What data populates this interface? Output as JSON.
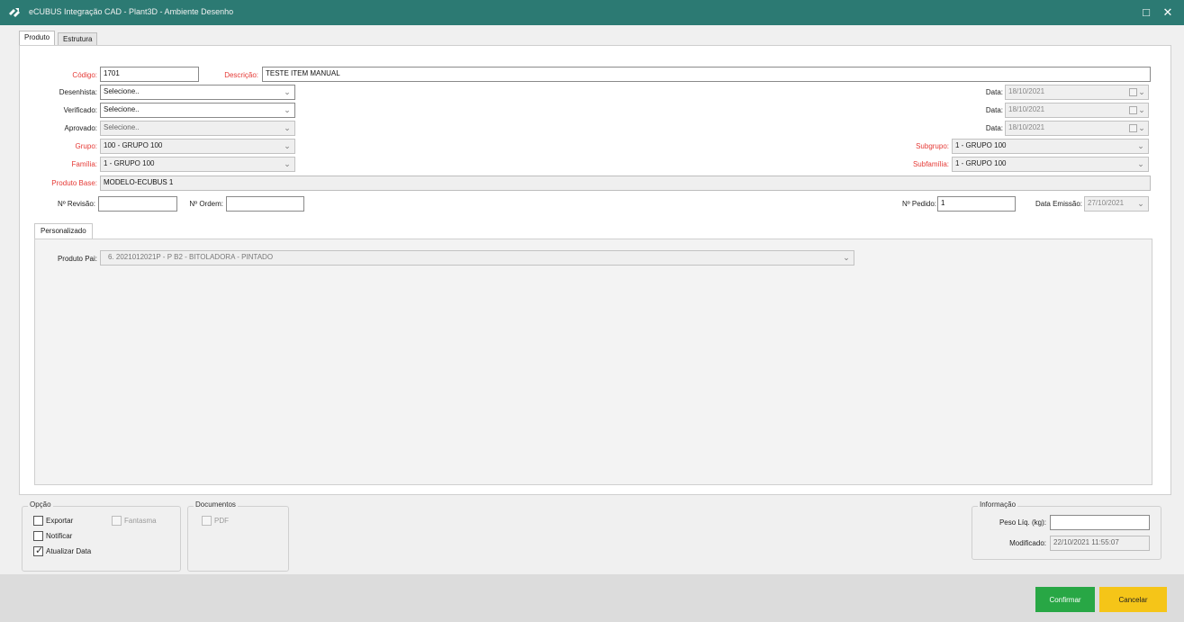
{
  "window": {
    "title": "eCUBUS Integração CAD - Plant3D - Ambiente Desenho",
    "maximize_icon": "□",
    "close_icon": "✕"
  },
  "tabs": [
    {
      "label": "Produto"
    },
    {
      "label": "Estrutura"
    }
  ],
  "form": {
    "codigo": {
      "label": "Código:",
      "value": "1701"
    },
    "descricao": {
      "label": "Descrição:",
      "value": "TESTE ITEM MANUAL"
    },
    "desenhista": {
      "label": "Desenhista:",
      "value": "Selecione.."
    },
    "verificado": {
      "label": "Verificado:",
      "value": "Selecione.."
    },
    "aprovado": {
      "label": "Aprovado:",
      "value": "Selecione.."
    },
    "grupo": {
      "label": "Grupo:",
      "value": "100 - GRUPO 100"
    },
    "familia": {
      "label": "Família:",
      "value": "1 - GRUPO 100"
    },
    "produto_base": {
      "label": "Produto Base:",
      "value": "MODELO-ECUBUS 1"
    },
    "revisao": {
      "label": "Nº Revisão:",
      "value": ""
    },
    "ordem": {
      "label": "Nº Ordem:",
      "value": ""
    },
    "pedido": {
      "label": "Nº Pedido:",
      "value": "1"
    },
    "data_emissao": {
      "label": "Data Emissão:",
      "value": "27/10/2021"
    },
    "data1": {
      "label": "Data:",
      "value": "18/10/2021"
    },
    "data2": {
      "label": "Data:",
      "value": "18/10/2021"
    },
    "data3": {
      "label": "Data:",
      "value": "18/10/2021"
    },
    "subgrupo": {
      "label": "Subgrupo:",
      "value": "1 - GRUPO 100"
    },
    "subfamilia": {
      "label": "Subfamília:",
      "value": "1 - GRUPO 100"
    }
  },
  "subtab": {
    "label": "Personalizado"
  },
  "personalizado": {
    "produto_pai": {
      "label": "Produto Pai:",
      "value": "6. 2021012021P - P B2 - BITOLADORA - PINTADO"
    }
  },
  "opcao": {
    "title": "Opção",
    "exportar": {
      "label": "Exportar",
      "checked": false
    },
    "fantasma": {
      "label": "Fantasma",
      "checked": false
    },
    "notificar": {
      "label": "Notificar",
      "checked": false
    },
    "atualizar_data": {
      "label": "Atualizar Data",
      "checked": true
    }
  },
  "documentos": {
    "title": "Documentos",
    "pdf": {
      "label": "PDF",
      "checked": false
    }
  },
  "informacao": {
    "title": "Informação",
    "peso": {
      "label": "Peso Líq. (kg):",
      "value": ""
    },
    "modificado": {
      "label": "Modificado:",
      "value": "22/10/2021 11:55:07"
    }
  },
  "buttons": {
    "confirmar": "Confirmar",
    "cancelar": "Cancelar"
  },
  "icons": {
    "chevron": "⌄",
    "check": "✓"
  },
  "colors": {
    "titlebar": "#2c7a73",
    "required_label": "#e53935",
    "confirm": "#28a745",
    "cancel": "#f5c518"
  }
}
